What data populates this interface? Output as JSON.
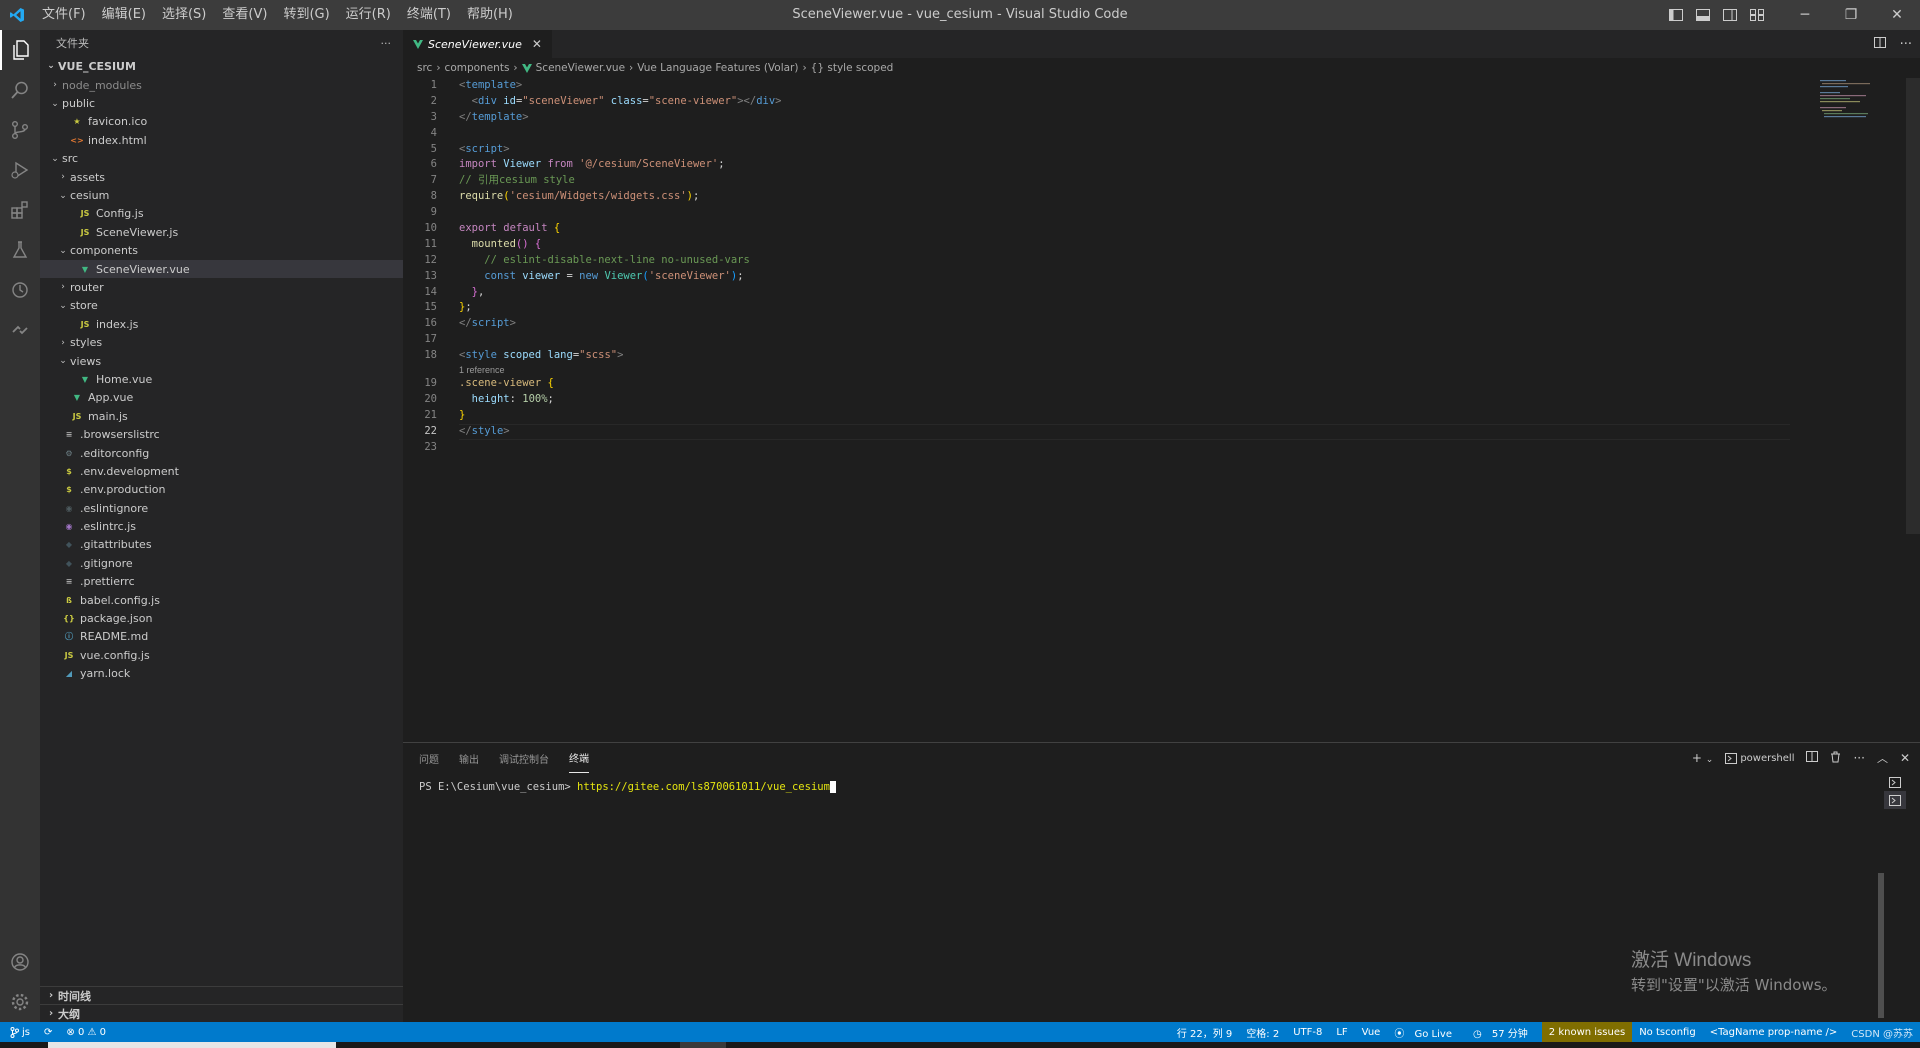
{
  "titlebar": {
    "menus": [
      "文件(F)",
      "编辑(E)",
      "选择(S)",
      "查看(V)",
      "转到(G)",
      "运行(R)",
      "终端(T)",
      "帮助(H)"
    ],
    "title": "SceneViewer.vue - vue_cesium - Visual Studio Code"
  },
  "sidebar": {
    "header": "文件夹",
    "more": "···",
    "root": "VUE_CESIUM",
    "tree": [
      {
        "label": "node_modules",
        "depth": 0,
        "arrow": "›",
        "icon": "",
        "dim": true
      },
      {
        "label": "public",
        "depth": 0,
        "arrow": "⌄",
        "icon": ""
      },
      {
        "label": "favicon.ico",
        "depth": 1,
        "arrow": "",
        "icon": "star"
      },
      {
        "label": "index.html",
        "depth": 1,
        "arrow": "",
        "icon": "html"
      },
      {
        "label": "src",
        "depth": 0,
        "arrow": "⌄",
        "icon": ""
      },
      {
        "label": "assets",
        "depth": 1,
        "arrow": "›",
        "icon": ""
      },
      {
        "label": "cesium",
        "depth": 1,
        "arrow": "⌄",
        "icon": ""
      },
      {
        "label": "Config.js",
        "depth": 2,
        "arrow": "",
        "icon": "js"
      },
      {
        "label": "SceneViewer.js",
        "depth": 2,
        "arrow": "",
        "icon": "js"
      },
      {
        "label": "components",
        "depth": 1,
        "arrow": "⌄",
        "icon": ""
      },
      {
        "label": "SceneViewer.vue",
        "depth": 2,
        "arrow": "",
        "icon": "vue",
        "selected": true
      },
      {
        "label": "router",
        "depth": 1,
        "arrow": "›",
        "icon": ""
      },
      {
        "label": "store",
        "depth": 1,
        "arrow": "⌄",
        "icon": ""
      },
      {
        "label": "index.js",
        "depth": 2,
        "arrow": "",
        "icon": "js"
      },
      {
        "label": "styles",
        "depth": 1,
        "arrow": "›",
        "icon": ""
      },
      {
        "label": "views",
        "depth": 1,
        "arrow": "⌄",
        "icon": ""
      },
      {
        "label": "Home.vue",
        "depth": 2,
        "arrow": "",
        "icon": "vue"
      },
      {
        "label": "App.vue",
        "depth": 1,
        "arrow": "",
        "icon": "vue"
      },
      {
        "label": "main.js",
        "depth": 1,
        "arrow": "",
        "icon": "js"
      },
      {
        "label": ".browserslistrc",
        "depth": 0,
        "arrow": "",
        "icon": "lines"
      },
      {
        "label": ".editorconfig",
        "depth": 0,
        "arrow": "",
        "icon": "gear"
      },
      {
        "label": ".env.development",
        "depth": 0,
        "arrow": "",
        "icon": "dollar"
      },
      {
        "label": ".env.production",
        "depth": 0,
        "arrow": "",
        "icon": "dollar"
      },
      {
        "label": ".eslintignore",
        "depth": 0,
        "arrow": "",
        "icon": "eslintg"
      },
      {
        "label": ".eslintrc.js",
        "depth": 0,
        "arrow": "",
        "icon": "eslint"
      },
      {
        "label": ".gitattributes",
        "depth": 0,
        "arrow": "",
        "icon": "git"
      },
      {
        "label": ".gitignore",
        "depth": 0,
        "arrow": "",
        "icon": "git"
      },
      {
        "label": ".prettierrc",
        "depth": 0,
        "arrow": "",
        "icon": "lines"
      },
      {
        "label": "babel.config.js",
        "depth": 0,
        "arrow": "",
        "icon": "babel"
      },
      {
        "label": "package.json",
        "depth": 0,
        "arrow": "",
        "icon": "json"
      },
      {
        "label": "README.md",
        "depth": 0,
        "arrow": "",
        "icon": "info"
      },
      {
        "label": "vue.config.js",
        "depth": 0,
        "arrow": "",
        "icon": "js"
      },
      {
        "label": "yarn.lock",
        "depth": 0,
        "arrow": "",
        "icon": "yarn"
      }
    ],
    "timeline": "时间线",
    "outline": "大纲"
  },
  "editor": {
    "tab_label": "SceneViewer.vue",
    "tab_close": "✕",
    "breadcrumb": [
      "src",
      "components",
      "SceneViewer.vue",
      "Vue Language Features (Volar)",
      "{} style scoped"
    ],
    "codelens": "1 reference",
    "current_line": 22,
    "lines": [
      [
        [
          "t-tag",
          "<"
        ],
        [
          "t-tn",
          "template"
        ],
        [
          "t-tag",
          ">"
        ]
      ],
      [
        [
          "t-df",
          "  "
        ],
        [
          "t-tag",
          "<"
        ],
        [
          "t-tn",
          "div"
        ],
        [
          "t-df",
          " "
        ],
        [
          "t-at",
          "id"
        ],
        [
          "t-df",
          "="
        ],
        [
          "t-st",
          "\"sceneViewer\""
        ],
        [
          "t-df",
          " "
        ],
        [
          "t-at",
          "class"
        ],
        [
          "t-df",
          "="
        ],
        [
          "t-st",
          "\"scene-viewer\""
        ],
        [
          "t-tag",
          "></"
        ],
        [
          "t-tn",
          "div"
        ],
        [
          "t-tag",
          ">"
        ]
      ],
      [
        [
          "t-tag",
          "</"
        ],
        [
          "t-tn",
          "template"
        ],
        [
          "t-tag",
          ">"
        ]
      ],
      [],
      [
        [
          "t-tag",
          "<"
        ],
        [
          "t-tn",
          "script"
        ],
        [
          "t-tag",
          ">"
        ]
      ],
      [
        [
          "t-kw",
          "import"
        ],
        [
          "t-df",
          " "
        ],
        [
          "t-id",
          "Viewer"
        ],
        [
          "t-df",
          " "
        ],
        [
          "t-kw",
          "from"
        ],
        [
          "t-df",
          " "
        ],
        [
          "t-st",
          "'@/cesium/SceneViewer'"
        ],
        [
          "t-df",
          ";"
        ]
      ],
      [
        [
          "t-cm",
          "// 引用cesium style"
        ]
      ],
      [
        [
          "t-fn",
          "require"
        ],
        [
          "t-p1",
          "("
        ],
        [
          "t-st",
          "'cesium/Widgets/widgets.css'"
        ],
        [
          "t-p1",
          ")"
        ],
        [
          "t-df",
          ";"
        ]
      ],
      [],
      [
        [
          "t-kw",
          "export"
        ],
        [
          "t-df",
          " "
        ],
        [
          "t-kw",
          "default"
        ],
        [
          "t-df",
          " "
        ],
        [
          "t-p1",
          "{"
        ]
      ],
      [
        [
          "t-df",
          "  "
        ],
        [
          "t-fn",
          "mounted"
        ],
        [
          "t-p2",
          "()"
        ],
        [
          "t-df",
          " "
        ],
        [
          "t-p2",
          "{"
        ]
      ],
      [
        [
          "t-df",
          "    "
        ],
        [
          "t-cm",
          "// eslint-disable-next-line no-unused-vars"
        ]
      ],
      [
        [
          "t-df",
          "    "
        ],
        [
          "t-bl",
          "const"
        ],
        [
          "t-df",
          " "
        ],
        [
          "t-id",
          "viewer"
        ],
        [
          "t-df",
          " = "
        ],
        [
          "t-bl",
          "new"
        ],
        [
          "t-df",
          " "
        ],
        [
          "t-cl",
          "Viewer"
        ],
        [
          "t-p3",
          "("
        ],
        [
          "t-st",
          "'sceneViewer'"
        ],
        [
          "t-p3",
          ")"
        ],
        [
          "t-df",
          ";"
        ]
      ],
      [
        [
          "t-df",
          "  "
        ],
        [
          "t-p2",
          "}"
        ],
        [
          "t-df",
          ","
        ]
      ],
      [
        [
          "t-p1",
          "}"
        ],
        [
          "t-df",
          ";"
        ]
      ],
      [
        [
          "t-tag",
          "</"
        ],
        [
          "t-tn",
          "script"
        ],
        [
          "t-tag",
          ">"
        ]
      ],
      [],
      [
        [
          "t-tag",
          "<"
        ],
        [
          "t-tn",
          "style"
        ],
        [
          "t-df",
          " "
        ],
        [
          "t-at",
          "scoped"
        ],
        [
          "t-df",
          " "
        ],
        [
          "t-at",
          "lang"
        ],
        [
          "t-df",
          "="
        ],
        [
          "t-st",
          "\"scss\""
        ],
        [
          "t-tag",
          ">"
        ]
      ],
      [
        [
          "t-cy",
          ".scene-viewer"
        ],
        [
          "t-df",
          " "
        ],
        [
          "t-p1",
          "{"
        ]
      ],
      [
        [
          "t-df",
          "  "
        ],
        [
          "t-at",
          "height"
        ],
        [
          "t-df",
          ": "
        ],
        [
          "t-nm",
          "100%"
        ],
        [
          "t-df",
          ";"
        ]
      ],
      [
        [
          "t-p1",
          "}"
        ]
      ],
      [
        [
          "t-tag",
          "</"
        ],
        [
          "t-tn",
          "style"
        ],
        [
          "t-tag",
          ">"
        ]
      ],
      []
    ]
  },
  "panel": {
    "tabs": [
      "问题",
      "输出",
      "调试控制台",
      "终端"
    ],
    "active_tab": "终端",
    "add": "+",
    "shell": "powershell",
    "prompt": "PS E:\\Cesium\\vue_cesium> ",
    "command": "https://gitee.com/ls870061011/vue_cesium"
  },
  "watermark": {
    "line1": "激活 Windows",
    "line2": "转到\"设置\"以激活 Windows。"
  },
  "statusbar": {
    "branch": "js",
    "problems": "⊗ 0 ⚠ 0",
    "position": "行 22，列 9",
    "spaces": "空格: 2",
    "encoding": "UTF-8",
    "eol": "LF",
    "language": "Vue",
    "golive": "Go Live",
    "time": "57 分钟",
    "issues": "2 known issues",
    "tsconfig": "No tsconfig",
    "tagname": "<TagName prop-name />",
    "csdn": "CSDN @苏苏"
  },
  "colors": {
    "accent": "#007acc",
    "warning_bg": "#806e00"
  }
}
